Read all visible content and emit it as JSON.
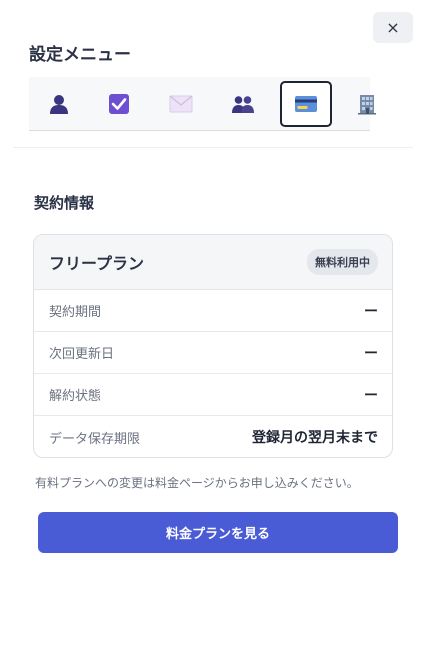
{
  "close_label": "×",
  "menu": {
    "title": "設定メニュー",
    "tabs": [
      {
        "name": "profile",
        "icon": "person-icon"
      },
      {
        "name": "tasks",
        "icon": "checkbox-icon"
      },
      {
        "name": "mail",
        "icon": "envelope-icon"
      },
      {
        "name": "team",
        "icon": "people-icon"
      },
      {
        "name": "billing",
        "icon": "credit-card-icon",
        "active": true
      },
      {
        "name": "organization",
        "icon": "building-icon"
      }
    ]
  },
  "contract": {
    "section_title": "契約情報",
    "plan_name": "フリープラン",
    "badge": "無料利用中",
    "rows": [
      {
        "label": "契約期間",
        "value": "ー"
      },
      {
        "label": "次回更新日",
        "value": "ー"
      },
      {
        "label": "解約状態",
        "value": "ー"
      },
      {
        "label": "データ保存期限",
        "value": "登録月の翌月末まで"
      }
    ]
  },
  "note": "有料プランへの変更は料金ページからお申し込みください。",
  "cta_label": "料金プランを見る",
  "colors": {
    "accent": "#4a5bd6",
    "tab_active_border": "#1d2433"
  }
}
